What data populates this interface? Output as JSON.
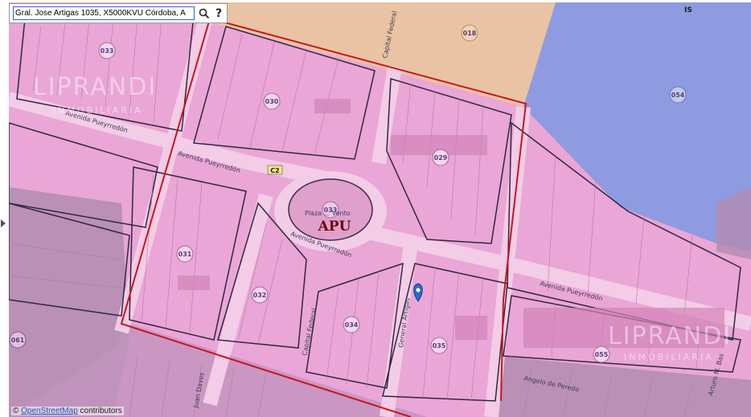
{
  "search": {
    "value": "Gral. Jose Artigas 1035, X5000KVU Córdoba, A",
    "search_icon": "search-icon",
    "help_label": "?"
  },
  "attribution": {
    "prefix": "© ",
    "link": "OpenStreetMap",
    "suffix": " contributors"
  },
  "zone_label": "APU",
  "corner_label": "IS",
  "c2_label": "C2",
  "streets": {
    "pueyrredon": "Avenida Pueyrredón",
    "pueyrredon_short": "Avenida Pueyrredón",
    "capital_federal": "Capital Federal",
    "general_artigas": "General Artigas",
    "juan_daves": "Juan Daves",
    "angelo_peredo": "Angelo de Peredo",
    "arturo_bas": "Arturo M. Bas",
    "plaza": "Plaza ... Vento"
  },
  "blocks": [
    "033",
    "030",
    "018",
    "029",
    "054",
    "031",
    "032",
    "034",
    "035",
    "055",
    "061"
  ],
  "watermark": {
    "brand": "LIPRANDI",
    "sub": "INMOBILIARIA"
  },
  "colors": {
    "zone_pink": "#e9a6d6",
    "orange_zone": "#e9c3a3",
    "blue_zone": "#8f9be0",
    "purple_zone": "#b18cb0",
    "boundary_red": "#c8141e",
    "marker": "#2b6cc4"
  }
}
